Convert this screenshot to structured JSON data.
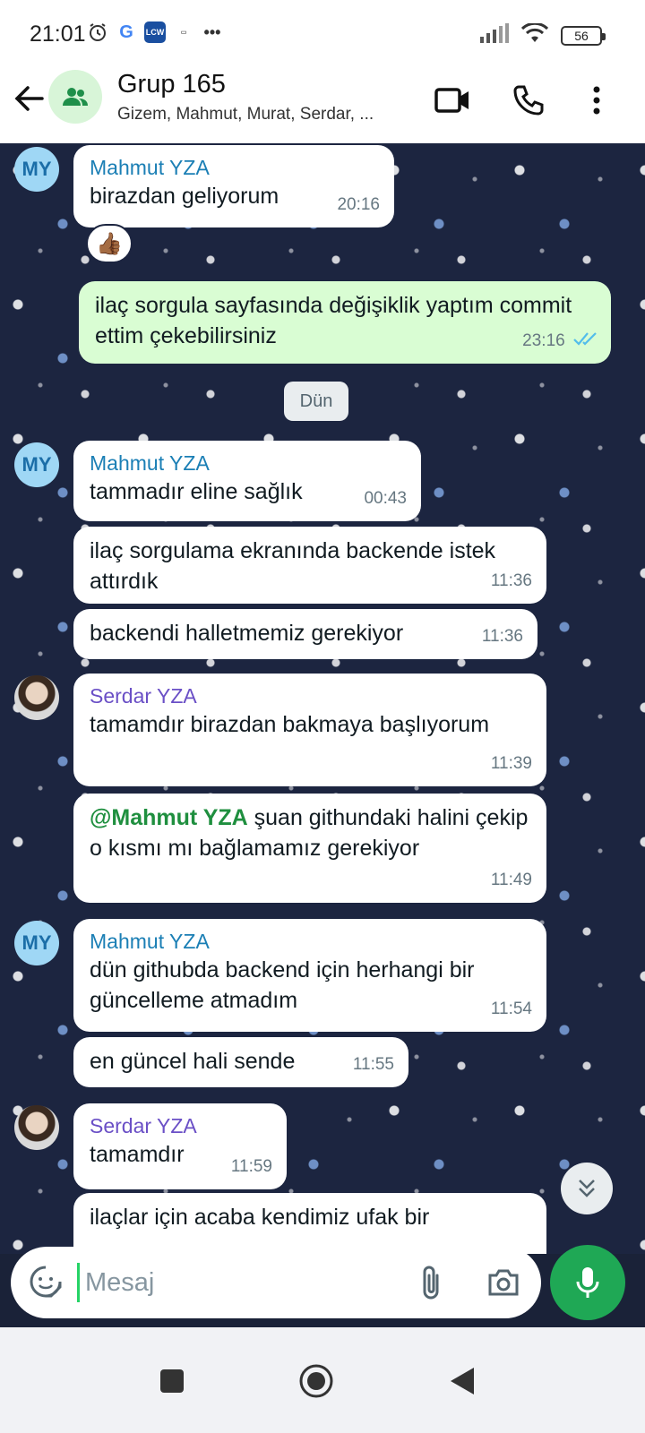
{
  "status_bar": {
    "time": "21:01",
    "battery": "56",
    "more": "•••"
  },
  "header": {
    "title": "Grup 165",
    "subtitle": "Gizem, Mahmut, Murat, Serdar, ..."
  },
  "date_separator": "Dün",
  "messages": [
    {
      "sender": "Mahmut YZA",
      "text": "birazdan geliyorum",
      "time": "20:16",
      "reaction": "👍🏾"
    },
    {
      "text": "ilaç sorgula sayfasında değişiklik yaptım commit ettim çekebilirsiniz",
      "time": "23:16",
      "outgoing": true
    },
    {
      "sender": "Mahmut YZA",
      "text": "tammadır eline sağlık",
      "time": "00:43"
    },
    {
      "text": "ilaç sorgulama ekranında backende istek attırdık",
      "time": "11:36"
    },
    {
      "text": "backendi halletmemiz gerekiyor",
      "time": "11:36"
    },
    {
      "sender": "Serdar YZA",
      "text": "tamamdır birazdan bakmaya başlıyorum",
      "time": "11:39"
    },
    {
      "mention": "@Mahmut YZA",
      "text": " şuan githundaki halini çekip o kısmı mı bağlamamız gerekiyor",
      "time": "11:49"
    },
    {
      "sender": "Mahmut YZA",
      "text": "dün githubda backend için herhangi bir güncelleme atmadım",
      "time": "11:54"
    },
    {
      "text": "en güncel hali sende",
      "time": "11:55"
    },
    {
      "sender": "Serdar YZA",
      "text": "tamamdır",
      "time": "11:59"
    },
    {
      "text": "ilaçlar için acaba kendimiz ufak bir"
    }
  ],
  "avatars": {
    "mahmut_initials": "MY"
  },
  "input": {
    "placeholder": "Mesaj"
  },
  "colors": {
    "accent": "#1fa855",
    "outgoing_bubble": "#d9fdd3",
    "mahmut_name": "#1b7fb5",
    "serdar_name": "#6a4fc6"
  }
}
